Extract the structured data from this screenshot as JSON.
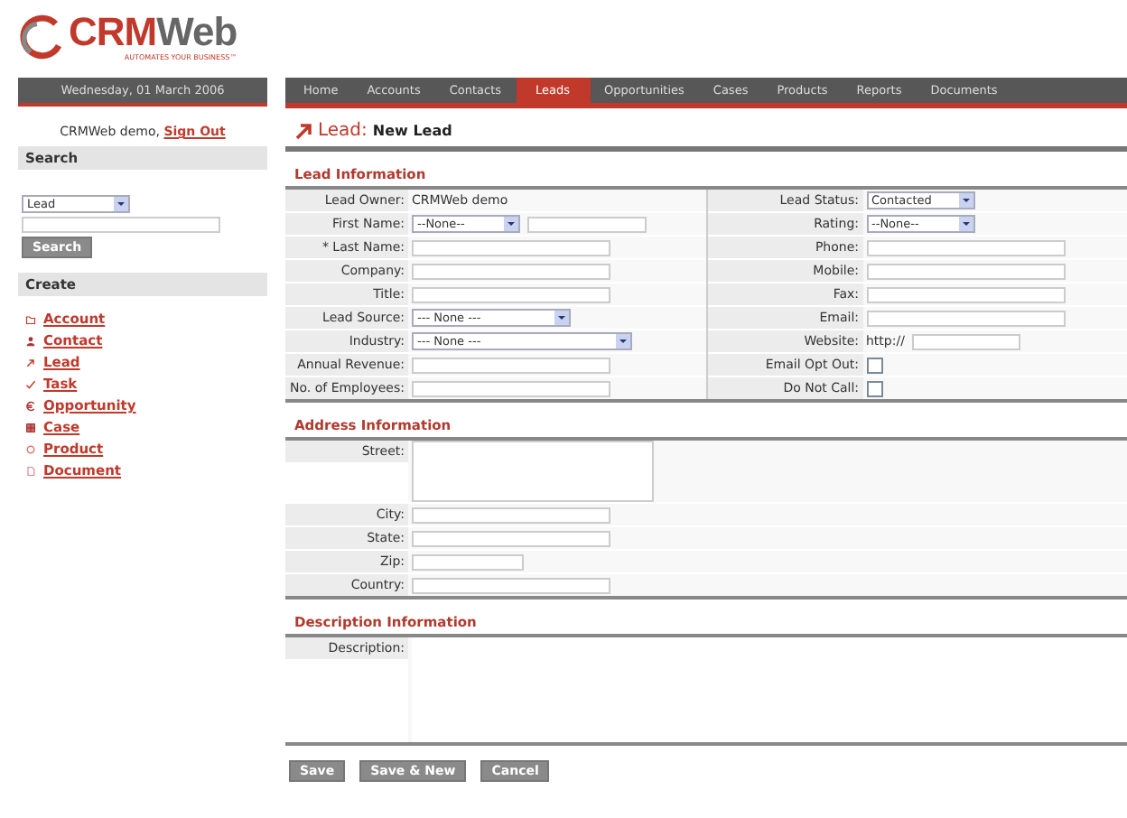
{
  "logo": {
    "name_a": "CRM",
    "name_b": "Web",
    "tagline": "AUTOMATES YOUR BUSINESS™"
  },
  "sidebar": {
    "date": "Wednesday, 01 March 2006",
    "user": "CRMWeb demo,",
    "sign_out": "Sign Out",
    "search": {
      "title": "Search",
      "module": "Lead",
      "button": "Search"
    },
    "create": {
      "title": "Create",
      "items": [
        {
          "label": "Account",
          "kind": "folder"
        },
        {
          "label": "Contact",
          "kind": "person"
        },
        {
          "label": "Lead",
          "kind": "arrow"
        },
        {
          "label": "Task",
          "kind": "check"
        },
        {
          "label": "Opportunity",
          "kind": "euro"
        },
        {
          "label": "Case",
          "kind": "grid"
        },
        {
          "label": "Product",
          "kind": "circle"
        },
        {
          "label": "Document",
          "kind": "page"
        }
      ]
    }
  },
  "tabs": [
    {
      "label": "Home",
      "selected": false
    },
    {
      "label": "Accounts",
      "selected": false
    },
    {
      "label": "Contacts",
      "selected": false
    },
    {
      "label": "Leads",
      "selected": true
    },
    {
      "label": "Opportunities",
      "selected": false
    },
    {
      "label": "Cases",
      "selected": false
    },
    {
      "label": "Products",
      "selected": false
    },
    {
      "label": "Reports",
      "selected": false
    },
    {
      "label": "Documents",
      "selected": false
    }
  ],
  "page_title": {
    "module": "Lead:",
    "record": "New Lead"
  },
  "lead_info": {
    "title": "Lead Information",
    "left": [
      {
        "label": "Lead Owner:",
        "kind": "static",
        "value": "CRMWeb demo"
      },
      {
        "label": "First Name:",
        "kind": "name",
        "value": "--None--"
      },
      {
        "label": "* Last Name:",
        "kind": "text"
      },
      {
        "label": "Company:",
        "kind": "text"
      },
      {
        "label": "Title:",
        "kind": "text"
      },
      {
        "label": "Lead Source:",
        "kind": "select",
        "value": "--- None ---"
      },
      {
        "label": "Industry:",
        "kind": "select_wide",
        "value": "--- None ---"
      },
      {
        "label": "Annual Revenue:",
        "kind": "text"
      },
      {
        "label": "No. of Employees:",
        "kind": "text"
      }
    ],
    "right": [
      {
        "label": "Lead Status:",
        "kind": "select_short",
        "value": "Contacted"
      },
      {
        "label": "Rating:",
        "kind": "select_short",
        "value": "--None--"
      },
      {
        "label": "Phone:",
        "kind": "text"
      },
      {
        "label": "Mobile:",
        "kind": "text"
      },
      {
        "label": "Fax:",
        "kind": "text"
      },
      {
        "label": "Email:",
        "kind": "text"
      },
      {
        "label": "Website:",
        "kind": "url",
        "value": "http://"
      },
      {
        "label": "Email Opt Out:",
        "kind": "checkbox",
        "checked": false
      },
      {
        "label": "Do Not Call:",
        "kind": "checkbox",
        "checked": false
      }
    ]
  },
  "address_info": {
    "title": "Address Information",
    "fields": [
      {
        "label": "Street:",
        "kind": "textarea"
      },
      {
        "label": "City:",
        "kind": "text"
      },
      {
        "label": "State:",
        "kind": "text"
      },
      {
        "label": "Zip:",
        "kind": "text_short"
      },
      {
        "label": "Country:",
        "kind": "text"
      }
    ]
  },
  "description_info": {
    "title": "Description Information",
    "fields": [
      {
        "label": "Description:",
        "kind": "textarea_big"
      }
    ]
  },
  "buttons": [
    "Save",
    "Save & New",
    "Cancel"
  ]
}
